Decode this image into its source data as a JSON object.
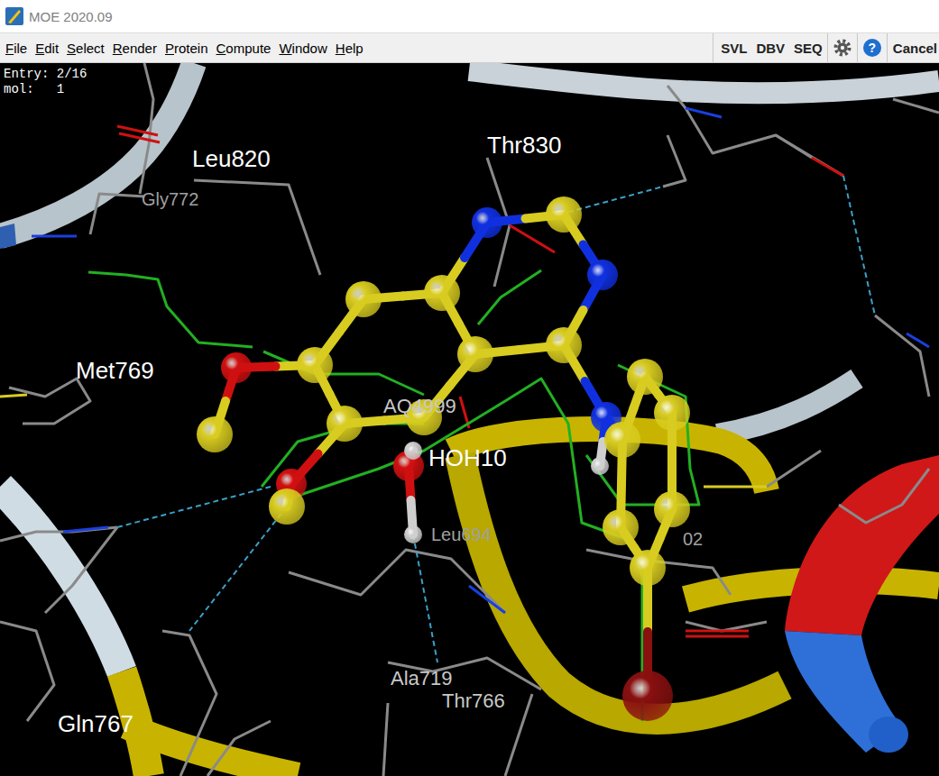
{
  "window": {
    "title": "MOE 2020.09"
  },
  "menu": [
    "File",
    "Edit",
    "Select",
    "Render",
    "Protein",
    "Compute",
    "Window",
    "Help"
  ],
  "toolbar": {
    "buttons": [
      "SVL",
      "DBV",
      "SEQ"
    ],
    "help": "?",
    "cancel": "Cancel"
  },
  "viewer": {
    "status": [
      "Entry: 2/16",
      "mol:   1"
    ],
    "labels": [
      {
        "text": "Leu820",
        "kind": "near"
      },
      {
        "text": "Gly772",
        "kind": "far"
      },
      {
        "text": "Thr830",
        "kind": "near"
      },
      {
        "text": "Met769",
        "kind": "near"
      },
      {
        "text": "AQ4999",
        "kind": "mid"
      },
      {
        "text": "HOH10",
        "kind": "near"
      },
      {
        "text": "Leu694",
        "kind": "far"
      },
      {
        "text": "Ala719",
        "kind": "mid"
      },
      {
        "text": "Thr766",
        "kind": "mid"
      },
      {
        "text": "Gln767",
        "kind": "near"
      },
      {
        "text": "02",
        "kind": "far"
      }
    ]
  }
}
